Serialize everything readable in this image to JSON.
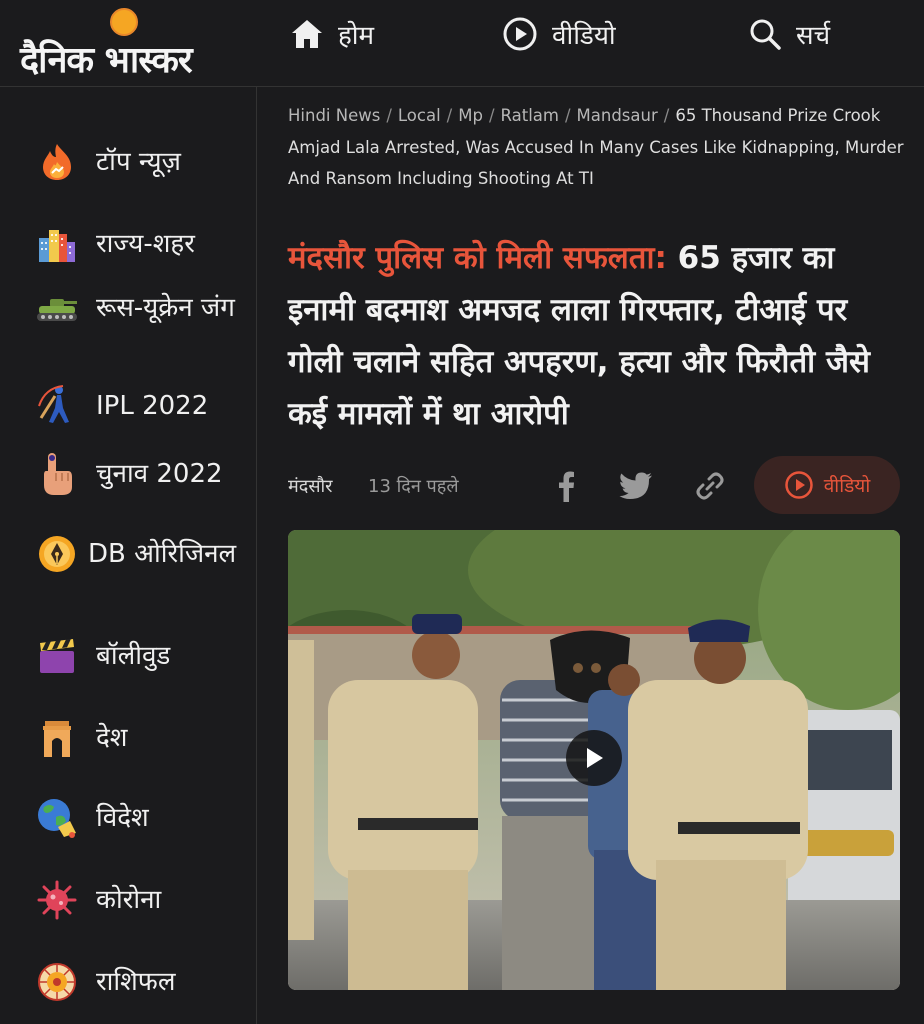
{
  "brand": {
    "name": "दैनिक भास्कर"
  },
  "nav": {
    "home": "होम",
    "video": "वीडियो",
    "search": "सर्च"
  },
  "sidebar": {
    "items": [
      {
        "label": "टॉप न्यूज़",
        "icon": "flame-icon"
      },
      {
        "label": "राज्य-शहर",
        "icon": "city-buildings-icon"
      },
      {
        "label": "रूस-यूक्रेन जंग",
        "icon": "tank-icon"
      },
      {
        "label": "IPL 2022",
        "icon": "cricket-player-icon"
      },
      {
        "label": "चुनाव 2022",
        "icon": "voting-finger-icon"
      },
      {
        "label": "DB ओरिजिनल",
        "icon": "pen-nib-badge-icon"
      },
      {
        "label": "बॉलीवुड",
        "icon": "clapperboard-icon"
      },
      {
        "label": "देश",
        "icon": "india-gate-icon"
      },
      {
        "label": "विदेश",
        "icon": "globe-icon"
      },
      {
        "label": "कोरोना",
        "icon": "virus-icon"
      },
      {
        "label": "राशिफल",
        "icon": "zodiac-wheel-icon"
      }
    ]
  },
  "breadcrumb": {
    "items": [
      "Hindi News",
      "Local",
      "Mp",
      "Ratlam",
      "Mandsaur"
    ],
    "current": "65 Thousand Prize Crook Amjad Lala Arrested, Was Accused In Many Cases Like Kidnapping, Murder And Ransom Including Shooting At TI"
  },
  "article": {
    "kicker": "मंदसौर पुलिस को मिली सफलता:",
    "title": " 65 हजार का इनामी बदमाश अमजद लाला गिरफ्तार, टीआई पर गोली चलाने सहित अपहरण, हत्या और फिरौती जैसे कई मामलों में था आरोपी",
    "city": "मंदसौर",
    "time": "13 दिन पहले",
    "video_label": "वीडियो"
  },
  "colors": {
    "accent": "#e8553b",
    "background": "#1b1b1d",
    "text": "#f2f2f2"
  }
}
